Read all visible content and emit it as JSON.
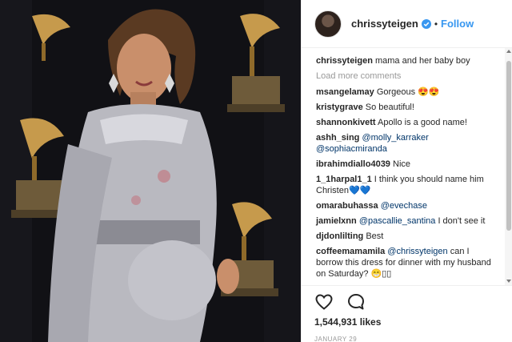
{
  "post": {
    "header": {
      "username": "chrissyteigen",
      "separator": "•",
      "follow_label": "Follow",
      "verified_icon": "verified-badge-icon",
      "brand_color": "#3897f0"
    },
    "comments": [
      {
        "user": "chrissyteigen",
        "text": "mama and her baby boy"
      },
      {
        "user": "msangelamay",
        "text": "Gorgeous 😍😍"
      },
      {
        "user": "kristygrave",
        "text": "So beautiful!"
      },
      {
        "user": "shannonkivett",
        "text": "Apollo is a good name!"
      },
      {
        "user": "ashh_sing",
        "mentions": [
          "@molly_karraker",
          "@sophiacmiranda"
        ]
      },
      {
        "user": "ibrahimdiallo4039",
        "text": "Nice"
      },
      {
        "user": "1_1harpal1_1",
        "text": "I think you should name him Christen💙💙"
      },
      {
        "user": "omarabuhassa",
        "mentions": [
          "@evechase"
        ]
      },
      {
        "user": "jamielxnn",
        "mention": "@pascallie_santina",
        "text": "I don't see it"
      },
      {
        "user": "djdonlilting",
        "text": "Best"
      },
      {
        "user": "coffeemamamila",
        "mention": "@chrissyteigen",
        "text": "can I borrow this dress for dinner with my husband on Saturday? 😁▯▯"
      }
    ],
    "load_more_label": "Load more comments",
    "actions": {
      "like_icon": "heart-icon",
      "comment_icon": "comment-bubble-icon"
    },
    "likes_text": "1,544,931 likes",
    "date_text": "JANUARY 29"
  }
}
